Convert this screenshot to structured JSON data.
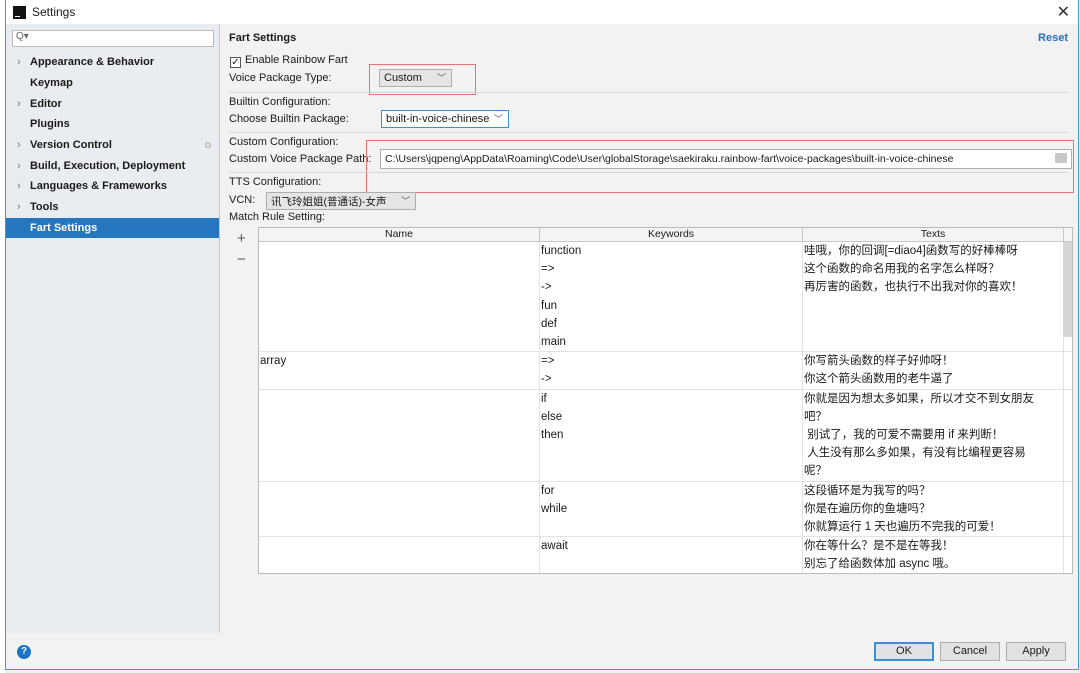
{
  "window": {
    "title": "Settings",
    "icon": "intellij-icon",
    "close_icon": "close-icon"
  },
  "sidebar": {
    "search_placeholder": "Q▾",
    "items": [
      {
        "label": "Appearance & Behavior",
        "expandable": true
      },
      {
        "label": "Keymap",
        "expandable": false
      },
      {
        "label": "Editor",
        "expandable": true
      },
      {
        "label": "Plugins",
        "expandable": false
      },
      {
        "label": "Version Control",
        "expandable": true
      },
      {
        "label": "Build, Execution, Deployment",
        "expandable": true
      },
      {
        "label": "Languages & Frameworks",
        "expandable": true
      },
      {
        "label": "Tools",
        "expandable": true
      },
      {
        "label": "Fart Settings",
        "expandable": false,
        "selected": true
      }
    ]
  },
  "main": {
    "title": "Fart Settings",
    "reset": "Reset",
    "enable_label": "Enable Rainbow Fart",
    "enable_checked": true,
    "voice_type_label": "Voice Package Type:",
    "voice_type_value": "Custom",
    "builtin_header": "Builtin Configuration:",
    "builtin_label": "Choose Builtin Package:",
    "builtin_value": "built-in-voice-chinese",
    "custom_header": "Custom Configuration:",
    "custom_label": "Custom Voice Package Path:",
    "custom_value": "C:\\Users\\jqpeng\\AppData\\Roaming\\Code\\User\\globalStorage\\saekiraku.rainbow-fart\\voice-packages\\built-in-voice-chinese",
    "tts_header": "TTS Configuration:",
    "vcn_label": "VCN:",
    "vcn_value": "讯飞玲姐姐(普通话)-女声",
    "match_header": "Match Rule Setting:",
    "add": "+",
    "remove": "−",
    "table": {
      "headers": [
        "Name",
        "Keywords",
        "Texts"
      ],
      "rows": [
        {
          "name": "",
          "keywords": [
            "function",
            "=>",
            "->",
            "fun",
            "def",
            "main"
          ],
          "texts": [
            "哇哦，你的回调[=diao4]函数写的好棒棒呀",
            "这个函数的命名用我的名字怎么样呀？",
            "再厉害的函数，也执行不出我对你的喜欢！"
          ]
        },
        {
          "name": "array",
          "keywords": [
            "=>",
            "->"
          ],
          "texts": [
            "你写箭头函数的样子好帅呀！",
            "你这个箭头函数用的老牛逼了"
          ]
        },
        {
          "name": "",
          "keywords": [
            "if",
            "else",
            "then"
          ],
          "texts": [
            "你就是因为想太多如果，所以才交不到女朋友",
            "吧？",
            " 别试了，我的可爱不需要用 if 来判断！",
            " 人生没有那么多如果，有没有比编程更容易",
            "呢？"
          ]
        },
        {
          "name": "",
          "keywords": [
            "for",
            "while"
          ],
          "texts": [
            "这段循环是为我写的吗？",
            "你是在遍历你的鱼塘吗？",
            "你就算运行 1 天也遍历不完我的可爱！"
          ]
        },
        {
          "name": "",
          "keywords": [
            "await"
          ],
          "texts": [
            "你在等什么？是不是在等我！",
            "别忘了给函数体加 async 哦。"
          ]
        }
      ]
    }
  },
  "footer": {
    "ok": "OK",
    "cancel": "Cancel",
    "apply": "Apply",
    "help": "?"
  },
  "colors": {
    "accent": "#2675bf",
    "highlight_box": "#f07070"
  }
}
